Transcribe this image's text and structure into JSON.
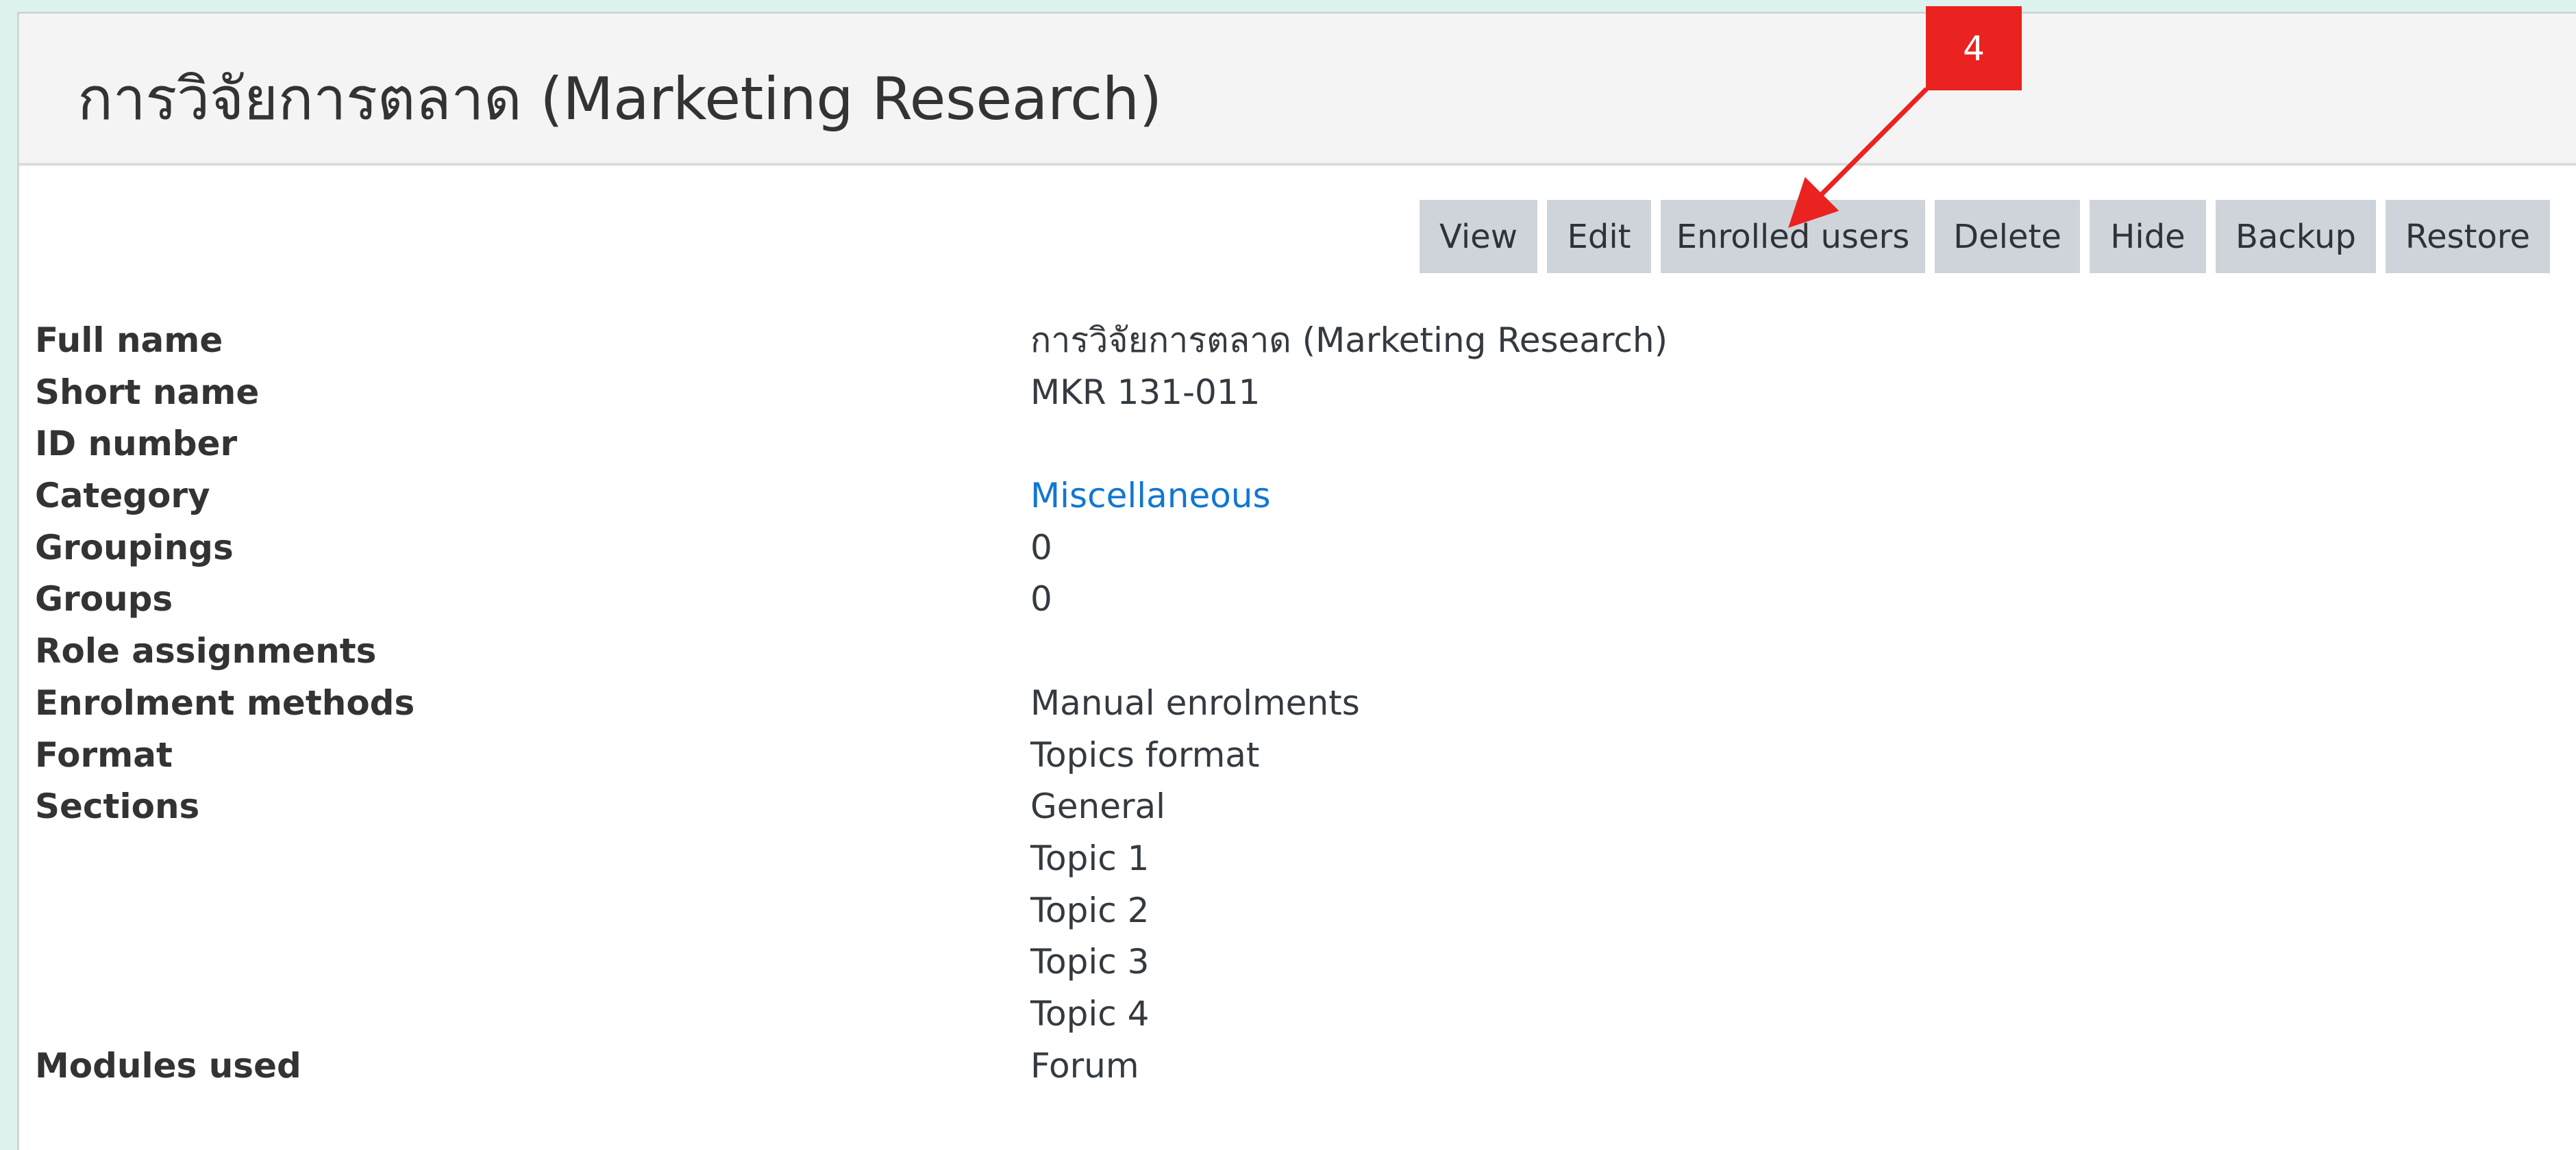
{
  "course": {
    "title": "การวิจัยการตลาด (Marketing Research)"
  },
  "actions": {
    "view": "View",
    "edit": "Edit",
    "enrolled_users": "Enrolled users",
    "delete": "Delete",
    "hide": "Hide",
    "backup": "Backup",
    "restore": "Restore"
  },
  "details": [
    {
      "label": "Full name",
      "value": "การวิจัยการตลาด (Marketing Research)"
    },
    {
      "label": "Short name",
      "value": "MKR 131-011"
    },
    {
      "label": "ID number",
      "value": ""
    },
    {
      "label": "Category",
      "value": "Miscellaneous"
    },
    {
      "label": "Groupings",
      "value": "0"
    },
    {
      "label": "Groups",
      "value": "0"
    },
    {
      "label": "Role assignments",
      "value": ""
    },
    {
      "label": "Enrolment methods",
      "value": "Manual enrolments"
    },
    {
      "label": "Format",
      "value": "Topics format"
    },
    {
      "label": "Sections",
      "value": "General"
    },
    {
      "label": "",
      "value": "Topic 1"
    },
    {
      "label": "",
      "value": "Topic 2"
    },
    {
      "label": "",
      "value": "Topic 3"
    },
    {
      "label": "",
      "value": "Topic 4"
    },
    {
      "label": "Modules used",
      "value": "Forum"
    }
  ],
  "annotation": {
    "step_number": "4",
    "color": "#ea2320"
  },
  "colors": {
    "link": "#1177d1",
    "button_bg": "#ced4da",
    "header_bg": "#f4f4f4",
    "page_bg": "#def3ef"
  }
}
